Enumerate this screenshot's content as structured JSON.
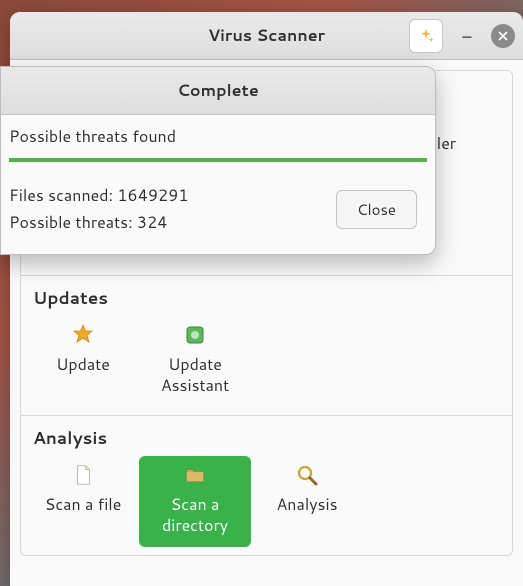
{
  "titlebar": {
    "title": "Virus Scanner"
  },
  "dialog": {
    "title": "Complete",
    "threats_found": "Possible threats found",
    "files_scanned_label": "Files scanned:",
    "files_scanned_value": "1649291",
    "possible_threats_label": "Possible threats:",
    "possible_threats_value": "324",
    "close": "Close"
  },
  "sections": {
    "top_row": {
      "scheduler": "Scheduler"
    },
    "updates": {
      "title": "Updates",
      "update": "Update",
      "update_assistant_l1": "Update",
      "update_assistant_l2": "Assistant"
    },
    "analysis": {
      "title": "Analysis",
      "scan_file": "Scan a file",
      "scan_dir_l1": "Scan a",
      "scan_dir_l2": "directory",
      "analysis": "Analysis"
    }
  }
}
